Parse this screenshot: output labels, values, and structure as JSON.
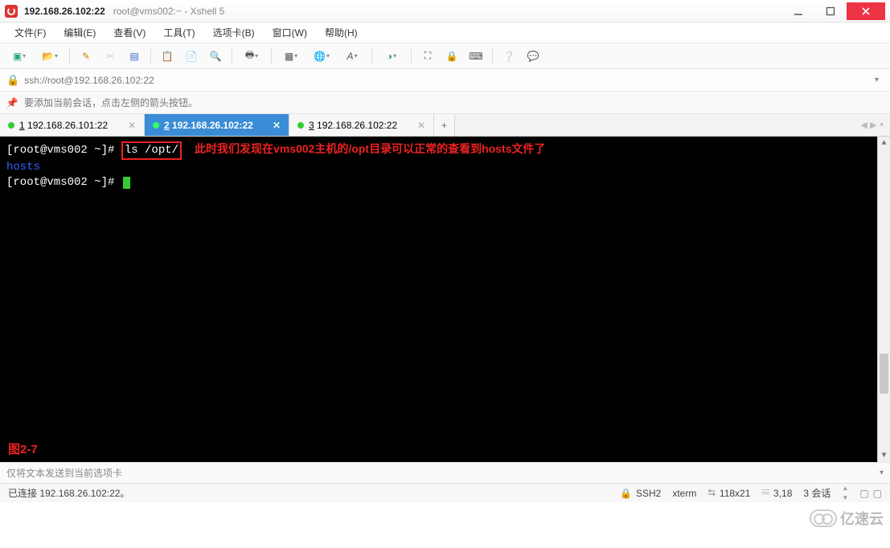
{
  "titlebar": {
    "main": "192.168.26.102:22",
    "sub": "root@vms002:~ - Xshell 5"
  },
  "menu": {
    "file": "文件(F)",
    "edit": "编辑(E)",
    "view": "查看(V)",
    "tools": "工具(T)",
    "tabs": "选项卡(B)",
    "window": "窗口(W)",
    "help": "帮助(H)"
  },
  "address": {
    "url": "ssh://root@192.168.26.102:22"
  },
  "hint": {
    "text": "要添加当前会话，点击左侧的箭头按钮。"
  },
  "tabs": [
    {
      "num": "1",
      "label": "192.168.26.101:22",
      "active": false
    },
    {
      "num": "2",
      "label": "192.168.26.102:22",
      "active": true
    },
    {
      "num": "3",
      "label": "192.168.26.102:22",
      "active": false
    }
  ],
  "term": {
    "prompt1_pre": "[root@vms002 ~]# ",
    "cmd": "ls /opt/",
    "annotation": "此时我们发现在vms002主机的/opt目录可以正常的查看到hosts文件了",
    "out1": "hosts",
    "prompt2": "[root@vms002 ~]# ",
    "figure": "图2-7"
  },
  "senddrop": {
    "label": "仅将文本发送到当前选项卡"
  },
  "status": {
    "conn": "已连接 192.168.26.102:22。",
    "proto": "SSH2",
    "termtype": "xterm",
    "size": "118x21",
    "pos": "3,18",
    "sessions": "3 会话"
  },
  "watermark": "亿速云"
}
